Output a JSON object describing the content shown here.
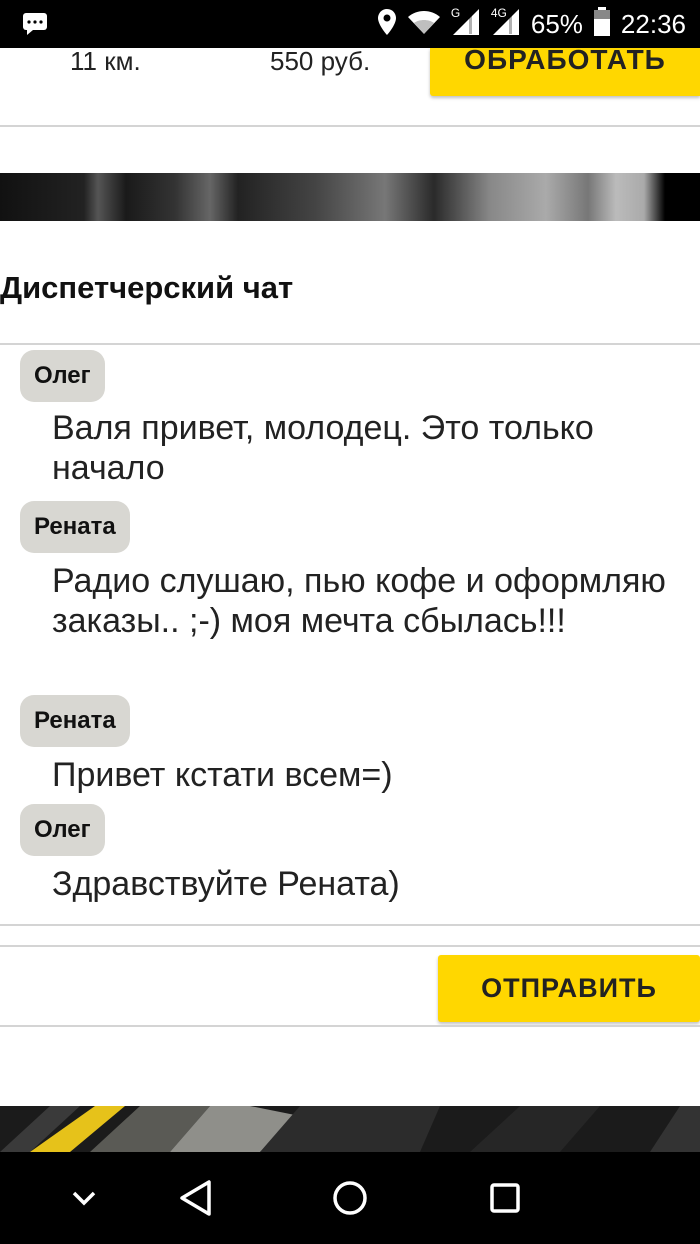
{
  "status_bar": {
    "network_g": "G",
    "network_4g": "4G",
    "battery": "65%",
    "time": "22:36",
    "icons": [
      "message-icon",
      "location-icon",
      "wifi-icon",
      "signal-icon",
      "signal-icon",
      "battery-icon"
    ]
  },
  "order": {
    "distance": "11 км.",
    "price": "550 руб.",
    "process_label": "ОБРАБОТАТЬ"
  },
  "chat": {
    "title": "Диспетчерский чат",
    "messages": [
      {
        "author": "Олег",
        "text": "Валя привет, молодец. Это только начало"
      },
      {
        "author": "Рената",
        "text": "Радио слушаю, пью кофе и оформляю заказы.. ;-) моя мечта сбылась!!!"
      },
      {
        "author": "Рената",
        "text": "Привет кстати всем=)"
      },
      {
        "author": "Олег",
        "text": "Здравствуйте Рената)"
      }
    ]
  },
  "compose": {
    "value": "",
    "send_label": "ОТПРАВИТЬ"
  },
  "colors": {
    "accent": "#ffd700",
    "chip": "#d8d7d2"
  },
  "nav_bar": {
    "icons": [
      "chevron-down-icon",
      "back-icon",
      "home-icon",
      "recents-icon"
    ]
  }
}
